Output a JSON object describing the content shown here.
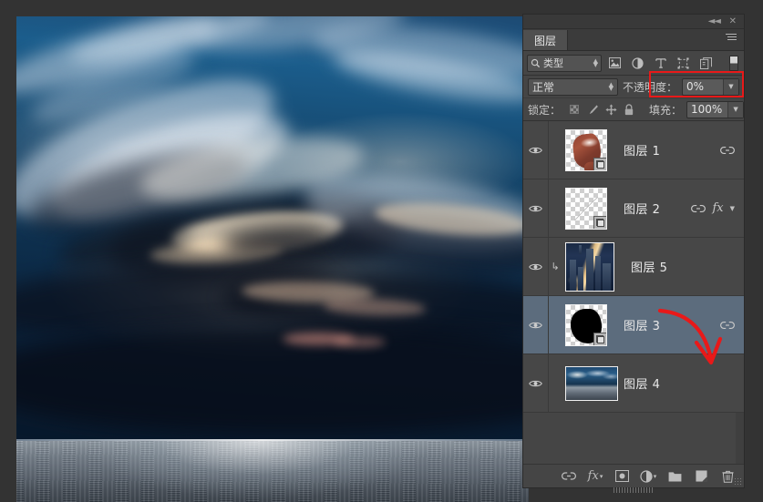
{
  "app": {
    "panel_title": "图层"
  },
  "panel": {
    "tab_label": "图层",
    "collapse_icon": "◄◄",
    "close_icon": "✕",
    "menu_icon": "panel-menu-icon"
  },
  "filter": {
    "search_icon": "search-icon",
    "kind_label": "类型",
    "icons": [
      {
        "name": "pixel-filter-icon",
        "glyph": "image"
      },
      {
        "name": "adjustment-filter-icon",
        "glyph": "adjust"
      },
      {
        "name": "type-filter-icon",
        "glyph": "T"
      },
      {
        "name": "shape-filter-icon",
        "glyph": "shape"
      },
      {
        "name": "smart-object-filter-icon",
        "glyph": "smart"
      }
    ],
    "toggle_name": "filter-enable-toggle"
  },
  "blend": {
    "mode_label": "正常",
    "opacity_label": "不透明度：",
    "opacity_value": "0%",
    "highlight_color": "#e81919"
  },
  "lock": {
    "label": "锁定：",
    "icons": [
      {
        "name": "lock-transparency-icon"
      },
      {
        "name": "lock-image-icon"
      },
      {
        "name": "lock-position-icon"
      },
      {
        "name": "lock-all-icon"
      }
    ],
    "fill_label": "填充：",
    "fill_value": "100%"
  },
  "layers": [
    {
      "name": "图层 1",
      "visible": true,
      "selected": false,
      "clipped": false,
      "has_fx": false,
      "has_link": true,
      "has_smart_badge": true,
      "thumb": "hand",
      "eye_icon": "eye-icon",
      "link_icon": "link-icon"
    },
    {
      "name": "图层 2",
      "visible": true,
      "selected": false,
      "clipped": false,
      "has_fx": true,
      "has_link": true,
      "has_smart_badge": true,
      "thumb": "stroke",
      "fx_label": "fx",
      "eye_icon": "eye-icon",
      "link_icon": "link-icon"
    },
    {
      "name": "图层 5",
      "visible": true,
      "selected": false,
      "clipped": true,
      "has_fx": false,
      "has_link": false,
      "has_smart_badge": false,
      "thumb": "city",
      "clip_icon": "↳",
      "eye_icon": "eye-icon"
    },
    {
      "name": "图层 3",
      "visible": true,
      "selected": true,
      "clipped": false,
      "has_fx": false,
      "has_link": true,
      "has_smart_badge": true,
      "thumb": "mask",
      "eye_icon": "eye-icon",
      "link_icon": "link-icon"
    },
    {
      "name": "图层 4",
      "visible": true,
      "selected": false,
      "clipped": false,
      "has_fx": false,
      "has_link": false,
      "has_smart_badge": false,
      "thumb": "sea",
      "eye_icon": "eye-icon"
    }
  ],
  "bottom_toolbar": [
    {
      "name": "link-layers-button",
      "glyph": "link"
    },
    {
      "name": "layer-style-button",
      "glyph": "fx"
    },
    {
      "name": "add-layer-mask-button",
      "glyph": "mask"
    },
    {
      "name": "new-fill-adjustment-button",
      "glyph": "adjust"
    },
    {
      "name": "new-group-button",
      "glyph": "folder"
    },
    {
      "name": "new-layer-button",
      "glyph": "newlayer"
    },
    {
      "name": "delete-layer-button",
      "glyph": "trash"
    }
  ],
  "annotations": {
    "arrow_color": "#e81919",
    "arrow_name": "red-arrow-annotation",
    "rect_name": "opacity-highlight-rect"
  },
  "canvas": {
    "image_description": "dramatic-sky-over-ocean"
  }
}
